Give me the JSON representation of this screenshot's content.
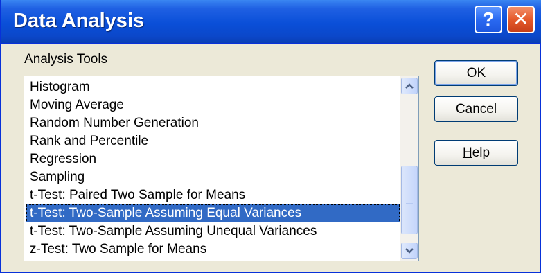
{
  "window": {
    "title": "Data Analysis",
    "help_glyph": "?",
    "close_glyph": "✕",
    "accent_color": "#0a4fd8"
  },
  "analysis_tools": {
    "label_first": "A",
    "label_rest": "nalysis Tools",
    "items": [
      "Histogram",
      "Moving Average",
      "Random Number Generation",
      "Rank and Percentile",
      "Regression",
      "Sampling",
      "t-Test: Paired Two Sample for Means",
      "t-Test: Two-Sample Assuming Equal Variances",
      "t-Test: Two-Sample Assuming Unequal Variances",
      "z-Test: Two Sample for Means"
    ],
    "selected": "t-Test: Two-Sample Assuming Equal Variances",
    "selection_color": "#316ac5"
  },
  "buttons": {
    "ok": "OK",
    "cancel": "Cancel",
    "help_first": "H",
    "help_rest": "elp"
  },
  "icons": {
    "scroll_up": "▲",
    "scroll_down": "▼"
  }
}
